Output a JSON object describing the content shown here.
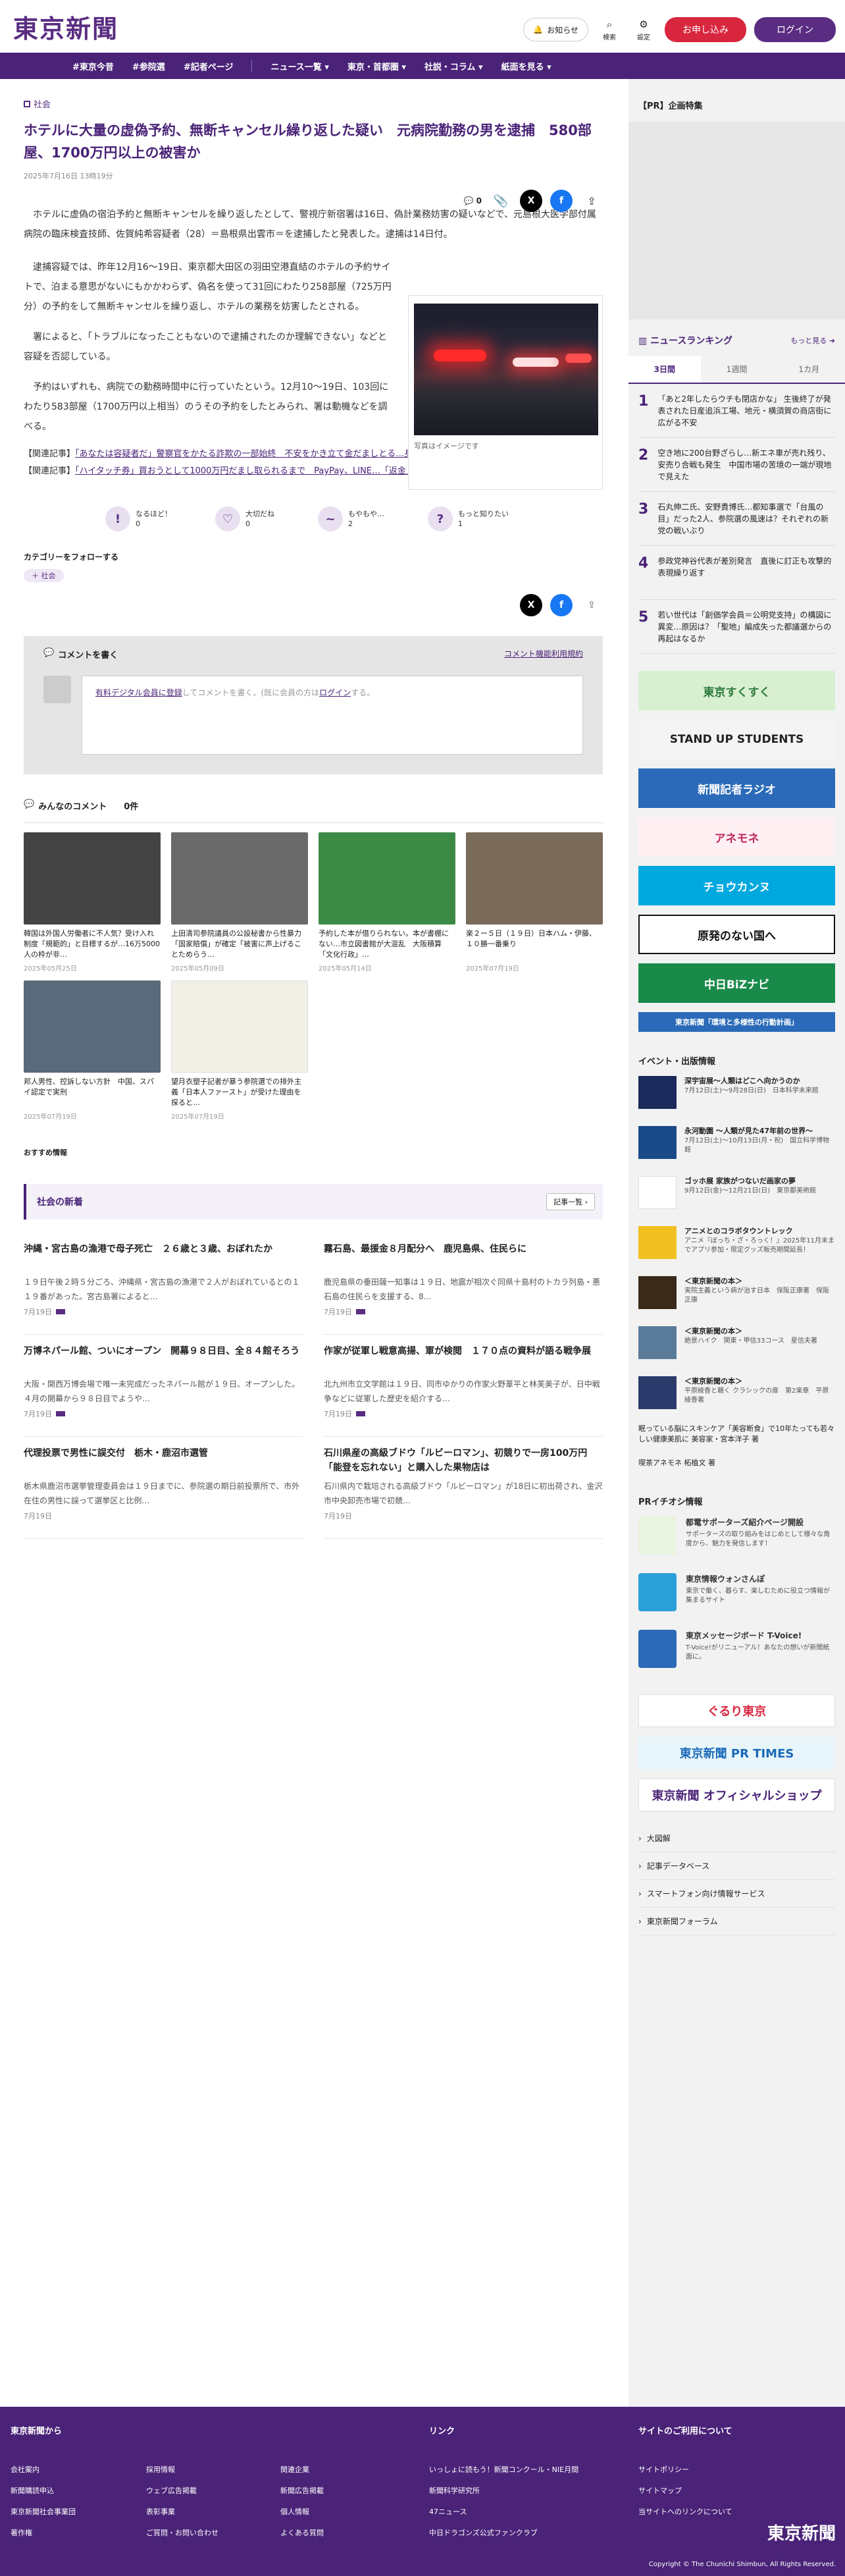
{
  "header": {
    "logo": "東京新聞",
    "notice": "お知らせ",
    "search": "検索",
    "settings": "設定",
    "apply": "お申し込み",
    "login": "ログイン"
  },
  "nav": [
    "#東京今昔",
    "#参院選",
    "#記者ページ",
    "ニュース一覧 ▾",
    "東京・首都圏 ▾",
    "社説・コラム ▾",
    "紙面を見る ▾"
  ],
  "article": {
    "category": "社会",
    "title": "ホテルに大量の虚偽予約、無断キャンセル繰り返した疑い　元病院勤務の男を逮捕　580部屋、1700万円以上の被害か",
    "date": "2025年7月16日 13時19分",
    "clip_count": "0",
    "p1": "ホテルに虚偽の宿泊予約と無断キャンセルを繰り返したとして、警視庁新宿署は16日、偽計業務妨害の疑いなどで、元島根大医学部付属病院の臨床検査技師、佐賀純希容疑者（28）＝島根県出雲市＝を逮捕したと発表した。逮捕は14日付。",
    "p2": "逮捕容疑では、昨年12月16〜19日、東京都大田区の羽田空港直結のホテルの予約サイトで、泊まる意思がないにもかかわらず、偽名を使って31回にわたり258部屋（725万円分）の予約をして無断キャンセルを繰り返し、ホテルの業務を妨害したとされる。",
    "p3": "署によると、「トラブルになったこともないので逮捕されたのか理解できない」などと容疑を否認している。",
    "p4": "予約はいずれも、病院での勤務時間中に行っていたという。12月10〜19日、103回にわたり583部屋（1700万円以上相当）のうその予約をしたとみられ、署は動機などを調べる。",
    "caption": "写真はイメージです",
    "rel1_prefix": "【関連記事】",
    "rel1": "「あなたは容疑者だ」警察官をかたる詐欺の一部始終　不安をかき立て金だましとる…身を守るにはどうする？",
    "rel2_prefix": "【関連記事】",
    "rel2": "「ハイタッチ券」買おうとして1000万円だまし取られるまで　PayPay、LINE…「返金」は詐欺かも"
  },
  "reactions": [
    {
      "label": "なるほど！",
      "count": "0",
      "icon": "!"
    },
    {
      "label": "大切だね",
      "count": "0",
      "icon": "♡"
    },
    {
      "label": "もやもや…",
      "count": "2",
      "icon": "~"
    },
    {
      "label": "もっと知りたい",
      "count": "1",
      "icon": "?"
    }
  ],
  "follow": {
    "label": "カテゴリーをフォローする",
    "tag": "＋ 社会"
  },
  "comment": {
    "heading": "コメントを書く",
    "rules": "コメント機能利用規約",
    "reg_link": "有料デジタル会員に登録",
    "mid": "してコメントを書く。(既に会員の方は",
    "login_link": "ログイン",
    "end": "する。"
  },
  "comments_header": {
    "label": "みんなのコメント",
    "count": "0件"
  },
  "cards": [
    {
      "text": "韓国は外国人労働者に不人気？受け入れ制度「規範的」と目標するが…16万5000人の枠が非…",
      "date": "2025年05月25日",
      "color": "#444"
    },
    {
      "text": "上田清司参院議員の公設秘書から性暴力「国家賠償」が確定「被害に声上げることためらう…",
      "date": "2025年05月09日",
      "color": "#6a6a6a"
    },
    {
      "text": "予約した本が借りられない。本が書棚にない…市立図書館が大混乱　大阪積算「文化行政」…",
      "date": "2025年05月14日",
      "color": "#3c8a46"
    },
    {
      "text": "楽２ー５日（１９日）日本ハム・伊藤、１０勝一番乗り",
      "date": "2025年07月19日",
      "color": "#7a6a5a"
    },
    {
      "text": "邦人男性、控訴しない方針　中国、スパイ認定で実刑",
      "date": "2025年07月19日",
      "color": "#5a6a7a"
    },
    {
      "text": "望月衣塑子記者が暴う参院選での排外主義「日本人ファースト」が受けた理由を探ると…",
      "date": "2025年07月19日",
      "color": "#f2efe6"
    }
  ],
  "recommend": "おすすめ情報",
  "news_section": {
    "title": "社会の新着",
    "more": "記事一覧 ›"
  },
  "news": [
    {
      "h": "沖縄・宮古島の漁港で母子死亡　２６歳と３歳、おぼれたか",
      "b": "１９日午後２時５分ごろ、沖縄県・宮古島の漁港で２人がおぼれているとの１１９番があった。宮古島署によると…",
      "d": "7月19日"
    },
    {
      "h": "霧石島、最援金８月配分へ　鹿児島県、住民らに",
      "b": "鹿児島県の垂田薩一知事は１９日、地震が相次ぐ同県十島村のトカラ列島・悪石島の住民らを支援する、8…",
      "d": "7月19日"
    },
    {
      "h": "万博ネパール館、ついにオープン　開幕９８日目、全８４館そろう",
      "b": "大阪・関西万博会場で唯一未完成だったネパール館が１９日、オープンした。４月の開幕から９８日目でようや…",
      "d": "7月19日"
    },
    {
      "h": "作家が従軍し戦意高揚、軍が検閲　１７０点の資料が語る戦争展",
      "b": "北九州市立文学館は１９日、同市ゆかりの作家火野葦平と林芙美子が、日中戦争などに従軍した歴史を紹介する…",
      "d": "7月19日"
    },
    {
      "h": "代理投票で男性に誤交付　栃木・鹿沼市選管",
      "b": "栃木県鹿沼市選挙管理委員会は１９日までに、参院選の期日前投票所で、市外在住の男性に誤って選挙区と比例…",
      "d": "7月19日"
    },
    {
      "h": "石川県産の高級ブドウ「ルビーロマン」、初競りで一房100万円「能登を忘れない」と購入した果物店は",
      "b": "石川県内で栽培される高級ブドウ「ルビーロマン」が18日に初出荷され、金沢市中央卸売市場で初競…",
      "d": "7月19日"
    }
  ],
  "sidebar": {
    "pr": "【PR】企画特集",
    "ranking_title": "ニュースランキング",
    "ranking_more": "もっと見る ➔",
    "tabs": [
      "3日間",
      "1週間",
      "1カ月"
    ],
    "ranking": [
      {
        "n": "1",
        "t": "「あと2年したらウチも閉店かな」 生後終了が発表された日産追浜工場、地元・横須賀の商店街に広がる不安"
      },
      {
        "n": "2",
        "t": "空き地に200台野ざらし…新エネ車が売れ残り、安売り合戦も発生　中国市場の苦境の一端が現地で見えた"
      },
      {
        "n": "3",
        "t": "石丸伸二氏、安野貴博氏…都知事選で「台風の目」だった2人、参院選の風速は？それぞれの新党の戦いぶり"
      },
      {
        "n": "4",
        "t": "参政党神谷代表が差別発言　直後に訂正も攻撃的表現繰り返す"
      },
      {
        "n": "5",
        "t": "若い世代は「創価学会員＝公明党支持」の構図に異変…原因は？「聖地」編成失った都議選からの再起はなるか"
      }
    ],
    "banners": [
      {
        "t": "東京すくすく",
        "bg": "#d8f0d0",
        "c": "#2a7a3a"
      },
      {
        "t": "STAND UP STUDENTS",
        "bg": "#f4f4f4",
        "c": "#222"
      },
      {
        "t": "新聞記者ラジオ",
        "bg": "#2a6ab8",
        "c": "#fff"
      },
      {
        "t": "アネモネ",
        "bg": "#fff0f4",
        "c": "#c02a5a"
      },
      {
        "t": "チョウカンヌ",
        "bg": "#00a8e0",
        "c": "#fff"
      },
      {
        "t": "原発のない国へ",
        "bg": "#fff",
        "c": "#111"
      },
      {
        "t": "中日BiZナビ",
        "bg": "#1a8a4a",
        "c": "#fff"
      },
      {
        "t": "東京新聞「環境と多様性の行動計画」",
        "bg": "#2a6ab8",
        "c": "#fff"
      }
    ],
    "events_title": "イベント・出版情報",
    "events": [
      {
        "t": "深宇宙展〜人類はどこへ向かうのか",
        "s": "7月12日(土)〜9月28日(日)　日本科学未来館",
        "bg": "#1a2a5a"
      },
      {
        "t": "永河動園 〜人類が見た47年前の世界〜",
        "s": "7月12日(土)〜10月13日(月・祝)　国立科学博物館",
        "bg": "#1a4a8a"
      },
      {
        "t": "ゴッホ展 家族がつないだ画家の夢",
        "s": "9月12日(金)〜12月21日(日)　東京都美術館",
        "bg": "#fff"
      },
      {
        "t": "アニメとのコラボタウントレック",
        "s": "アニメ『ぼっち・ざ・ろっく！』2025年11月末までアプリ参加・限定グッズ販売期間延長！",
        "bg": "#f0c020"
      },
      {
        "t": "＜東京新聞の本＞",
        "s": "実院主義という病が治す日本　保阪正康著　保阪正康",
        "bg": "#3a2a1a"
      },
      {
        "t": "＜東京新聞の本＞",
        "s": "絶景ハイク　関東・甲信33コース　星信夫著",
        "bg": "#5a7a9a"
      },
      {
        "t": "＜東京新聞の本＞",
        "s": "平原綾香と聴く クラシックの扉　第2楽章　平原綾香著",
        "bg": "#2a3a6a"
      }
    ],
    "ev_links": [
      "眠っている脳にスキンケア「美容断食」で10年たっても若々しい健康美肌に 美容家・宮本洋子 著",
      "喫茶アネモネ 柘植文 著"
    ],
    "pr2_title": "PRイチオシ情報",
    "pr2": [
      {
        "t": "都電サポーターズ紹介ページ開設",
        "s": "サポーターズの取り組みをはじめとして様々な角度から、魅力を発信します！",
        "bg": "#e8f4e0"
      },
      {
        "t": "東京情報ウォンさんぽ",
        "s": "東京で働く、暮らす、楽しむために役立つ情報が集まるサイト",
        "bg": "#2aa0d8"
      },
      {
        "t": "東京メッセージボード T-Voice!",
        "s": "T-Voice!がリニューアル！あなたの想いが新聞紙面に。",
        "bg": "#2a6ab8"
      }
    ],
    "side_banners": [
      {
        "t": "ぐるり東京",
        "bg": "#fff",
        "c": "#d8263e"
      },
      {
        "t": "東京新聞 PR TIMES",
        "bg": "#e8f6fb",
        "c": "#1a6ab8"
      },
      {
        "t": "東京新聞 オフィシャルショップ",
        "bg": "#fff",
        "c": "#4a2378"
      }
    ],
    "side_links": [
      "大図解",
      "記事データベース",
      "スマートフォン向け情報サービス",
      "東京新聞フォーラム"
    ]
  },
  "footer": {
    "h1": "東京新聞から",
    "h2": "リンク",
    "h3": "サイトのご利用について",
    "col1": [
      "会社案内",
      "新聞購読申込",
      "東京新聞社会事業団",
      "著作権"
    ],
    "col2": [
      "採用情報",
      "ウェブ広告掲載",
      "表彰事業",
      "ご質問・お問い合わせ"
    ],
    "col3": [
      "関連企業",
      "新聞広告掲載",
      "個人情報",
      "よくある質問"
    ],
    "col4": [
      "いっしょに読もう！新聞コンクール・NIE月間",
      "新聞科学研究所",
      "47ニュース",
      "中日ドラゴンズ公式ファンクラブ"
    ],
    "col5": [
      "サイトポリシー",
      "サイトマップ",
      "当サイトへのリンクについて"
    ],
    "logo": "東京新聞",
    "copyright": "Copyright © The Chunichi Shimbun, All Rights Reserved."
  }
}
